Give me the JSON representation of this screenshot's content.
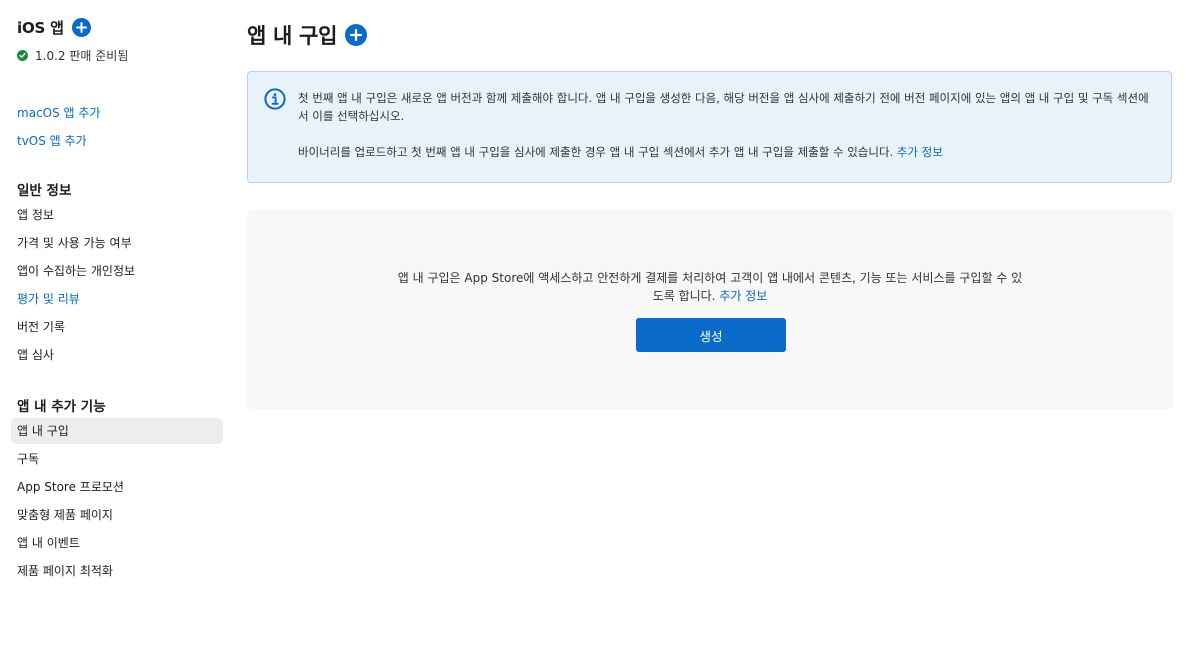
{
  "sidebar": {
    "app_title": "iOS 앱",
    "status": "1.0.2 판매 준비됨",
    "links": [
      "macOS 앱 추가",
      "tvOS 앱 추가"
    ],
    "general": {
      "heading": "일반 정보",
      "items": [
        "앱 정보",
        "가격 및 사용 가능 여부",
        "앱이 수집하는 개인정보",
        "평가 및 리뷰",
        "버전 기록",
        "앱 심사"
      ]
    },
    "features": {
      "heading": "앱 내 추가 기능",
      "items": [
        "앱 내 구입",
        "구독",
        "App Store 프로모션",
        "맞춤형 제품 페이지",
        "앱 내 이벤트",
        "제품 페이지 최적화"
      ]
    }
  },
  "main": {
    "title": "앱 내 구입",
    "info": {
      "line1": "첫 번째 앱 내 구입은 새로운 앱 버전과 함께 제출해야 합니다. 앱 내 구입을 생성한 다음, 해당 버전을 앱 심사에 제출하기 전에 버전 페이지에 있는 앱의 앱 내 구입 및 구독 섹션에서 이를 선택하십시오.",
      "line2": "바이너리를 업로드하고 첫 번째 앱 내 구입을 심사에 제출한 경우 앱 내 구입 섹션에서 추가 앱 내 구입을 제출할 수 있습니다.",
      "more_link": "추가 정보"
    },
    "empty": {
      "text": "앱 내 구입은 App Store에 액세스하고 안전하게 결제를 처리하여 고객이 앱 내에서 콘텐츠, 기능 또는 서비스를 구입할 수 있도록 합니다.",
      "more_link": "추가 정보",
      "button": "생성"
    }
  },
  "colors": {
    "accent": "#0a6ac9",
    "success": "#1d8a3a",
    "info_bg": "#e8f2fb"
  }
}
